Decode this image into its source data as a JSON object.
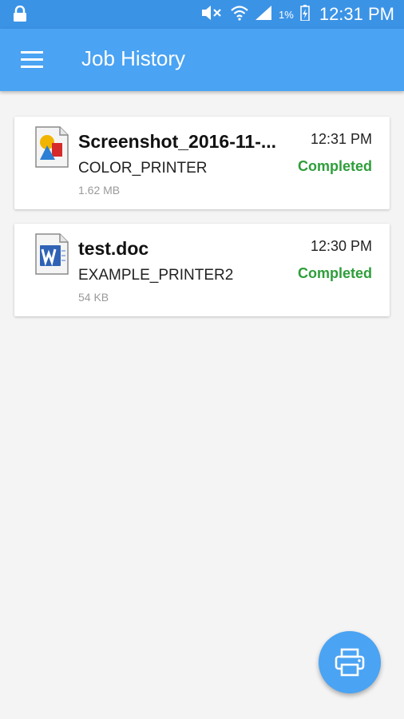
{
  "status_bar": {
    "battery_percent": "1%",
    "time": "12:31 PM"
  },
  "app_bar": {
    "title": "Job History"
  },
  "jobs": [
    {
      "file_name": "Screenshot_2016-11-...",
      "printer": "COLOR_PRINTER",
      "size": "1.62 MB",
      "time": "12:31 PM",
      "status": "Completed"
    },
    {
      "file_name": "test.doc",
      "printer": "EXAMPLE_PRINTER2",
      "size": "54 KB",
      "time": "12:30 PM",
      "status": "Completed"
    }
  ],
  "colors": {
    "accent": "#4aa3f3",
    "status_bar": "#3b93e6",
    "completed": "#2e9e3a"
  },
  "icons": {
    "menu": "menu-icon",
    "fab": "print-icon",
    "job_1": "image-file-icon",
    "job_2": "word-file-icon"
  }
}
